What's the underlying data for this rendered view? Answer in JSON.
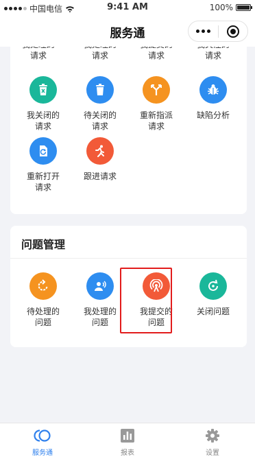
{
  "status_bar": {
    "carrier": "中国电信",
    "time": "9:41 AM",
    "battery": "100%"
  },
  "nav": {
    "title": "服务通"
  },
  "section_1": {
    "cut_row": [
      {
        "label": "我处理的\n请求"
      },
      {
        "label": "我处理的\n请求"
      },
      {
        "label": "我提交的\n请求"
      },
      {
        "label": "我关注的\n请求"
      }
    ],
    "items": [
      {
        "label": "我关闭的\n请求",
        "icon": "trash-x-icon",
        "color": "#1ab79a"
      },
      {
        "label": "待关闭的\n请求",
        "icon": "trash-icon",
        "color": "#2e8df0"
      },
      {
        "label": "重新指派\n请求",
        "icon": "reassign-icon",
        "color": "#f59320"
      },
      {
        "label": "缺陷分析",
        "icon": "bug-icon",
        "color": "#2e8df0"
      },
      {
        "label": "重新打开\n请求",
        "icon": "reopen-document-icon",
        "color": "#2e8df0"
      },
      {
        "label": "跟进请求",
        "icon": "running-person-icon",
        "color": "#f25a38"
      }
    ]
  },
  "section_2": {
    "title": "问题管理",
    "items": [
      {
        "label": "待处理的\n问题",
        "icon": "rotate-icon",
        "color": "#f59320"
      },
      {
        "label": "我处理的\n问题",
        "icon": "user-voice-icon",
        "color": "#2e8df0"
      },
      {
        "label": "我提交的\n问题",
        "icon": "broadcast-icon",
        "color": "#f25a38"
      },
      {
        "label": "关闭问题",
        "icon": "refresh-check-icon",
        "color": "#1ab79a"
      }
    ]
  },
  "tabs": [
    {
      "label": "服务通",
      "icon": "service-icon",
      "active": true
    },
    {
      "label": "报表",
      "icon": "chart-icon",
      "active": false
    },
    {
      "label": "设置",
      "icon": "gear-icon",
      "active": false
    }
  ],
  "colors": {
    "accent": "#2f80ed",
    "highlight": "#e21b1b"
  }
}
